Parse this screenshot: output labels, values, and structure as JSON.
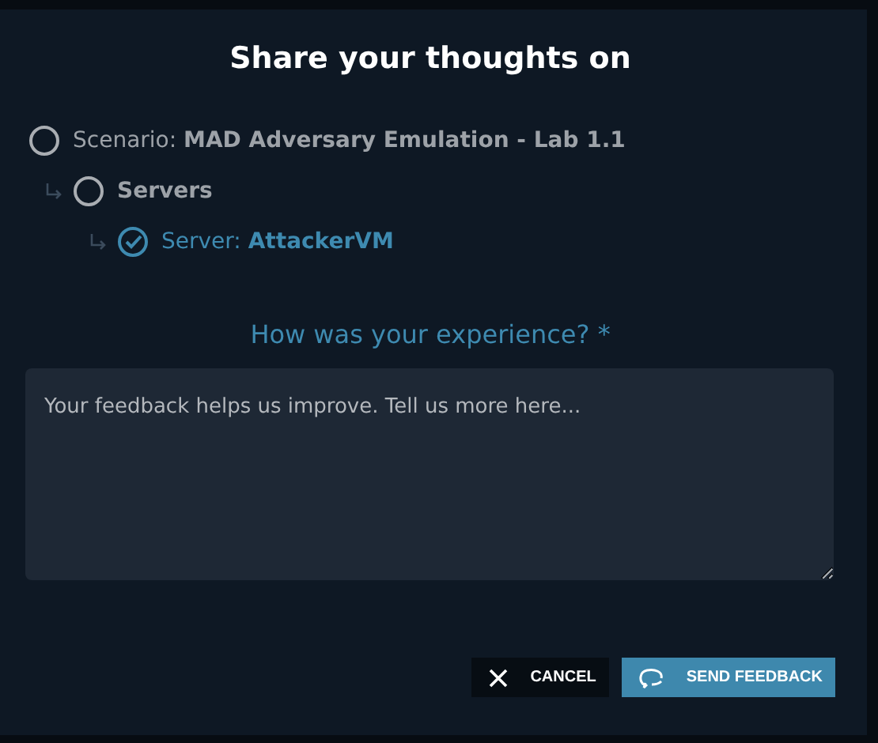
{
  "dialog": {
    "title": "Share your thoughts on"
  },
  "tree": [
    {
      "prefix": "Scenario:",
      "name": "MAD Adversary Emulation - Lab 1.1",
      "selected": false,
      "children": [
        {
          "name": "Servers",
          "selected": false,
          "children": [
            {
              "prefix": "Server:",
              "name": "AttackerVM",
              "selected": true
            }
          ]
        }
      ]
    }
  ],
  "question": {
    "label": "How was your experience? *"
  },
  "feedback": {
    "placeholder": "Your feedback helps us improve. Tell us more here..."
  },
  "buttons": [
    {
      "kind": "cancel",
      "label": "CANCEL"
    },
    {
      "kind": "send",
      "label": "SEND FEEDBACK"
    }
  ]
}
